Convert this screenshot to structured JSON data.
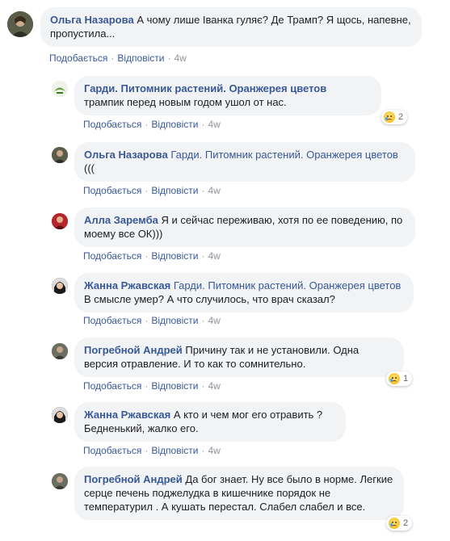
{
  "actions": {
    "like": "Подобається",
    "reply": "Відповісти",
    "separator": "·"
  },
  "comments": [
    {
      "author": "Ольга Назарова",
      "tag": "",
      "text": "А чому лише Іванка гуляє? Де Трамп? Я щось, напевне, пропустила...",
      "time": "4w",
      "reaction_count": "",
      "avatar": "avatar-olga"
    },
    {
      "author": "Гарди. Питомник растений. Оранжерея цветов",
      "tag": "",
      "text": "трампик перед новым годом ушол от нас.",
      "time": "4w",
      "reaction_count": "2",
      "avatar": "avatar-gardi"
    },
    {
      "author": "Ольга Назарова",
      "tag": "Гарди. Питомник растений. Оранжерея цветов",
      "text": "(((",
      "time": "4w",
      "reaction_count": "",
      "avatar": "avatar-olga"
    },
    {
      "author": "Алла Заремба",
      "tag": "",
      "text": "Я и сейчас переживаю, хотя по ее поведению, по моему все ОК)))",
      "time": "4w",
      "reaction_count": "",
      "avatar": "avatar-alla"
    },
    {
      "author": "Жанна Ржавская",
      "tag": "Гарди. Питомник растений. Оранжерея цветов",
      "text": "В смысле умер? А что случилось, что врач сказал?",
      "time": "4w",
      "reaction_count": "",
      "avatar": "avatar-zhanna"
    },
    {
      "author": "Погребной Андрей",
      "tag": "",
      "text": "Причину так и не установили. Одна версия отравление. И то как то сомнительно.",
      "time": "4w",
      "reaction_count": "1",
      "avatar": "avatar-andrei"
    },
    {
      "author": "Жанна Ржавская",
      "tag": "",
      "text": "А кто и чем мог его отравить ? Бедненький, жалко его.",
      "time": "4w",
      "reaction_count": "",
      "avatar": "avatar-zhanna"
    },
    {
      "author": "Погребной Андрей",
      "tag": "",
      "text": "Да бог знает. Ну все было в норме. Легкие серце печень поджелудка в кишечнике порядок не температурил . А кушать перестал. Слабел слабел и все.",
      "time": "4w",
      "reaction_count": "2",
      "avatar": "avatar-andrei"
    }
  ],
  "colors": {
    "link": "#385898",
    "bubble": "#f2f3f5",
    "meta": "#90949c",
    "text": "#1c1e21"
  }
}
